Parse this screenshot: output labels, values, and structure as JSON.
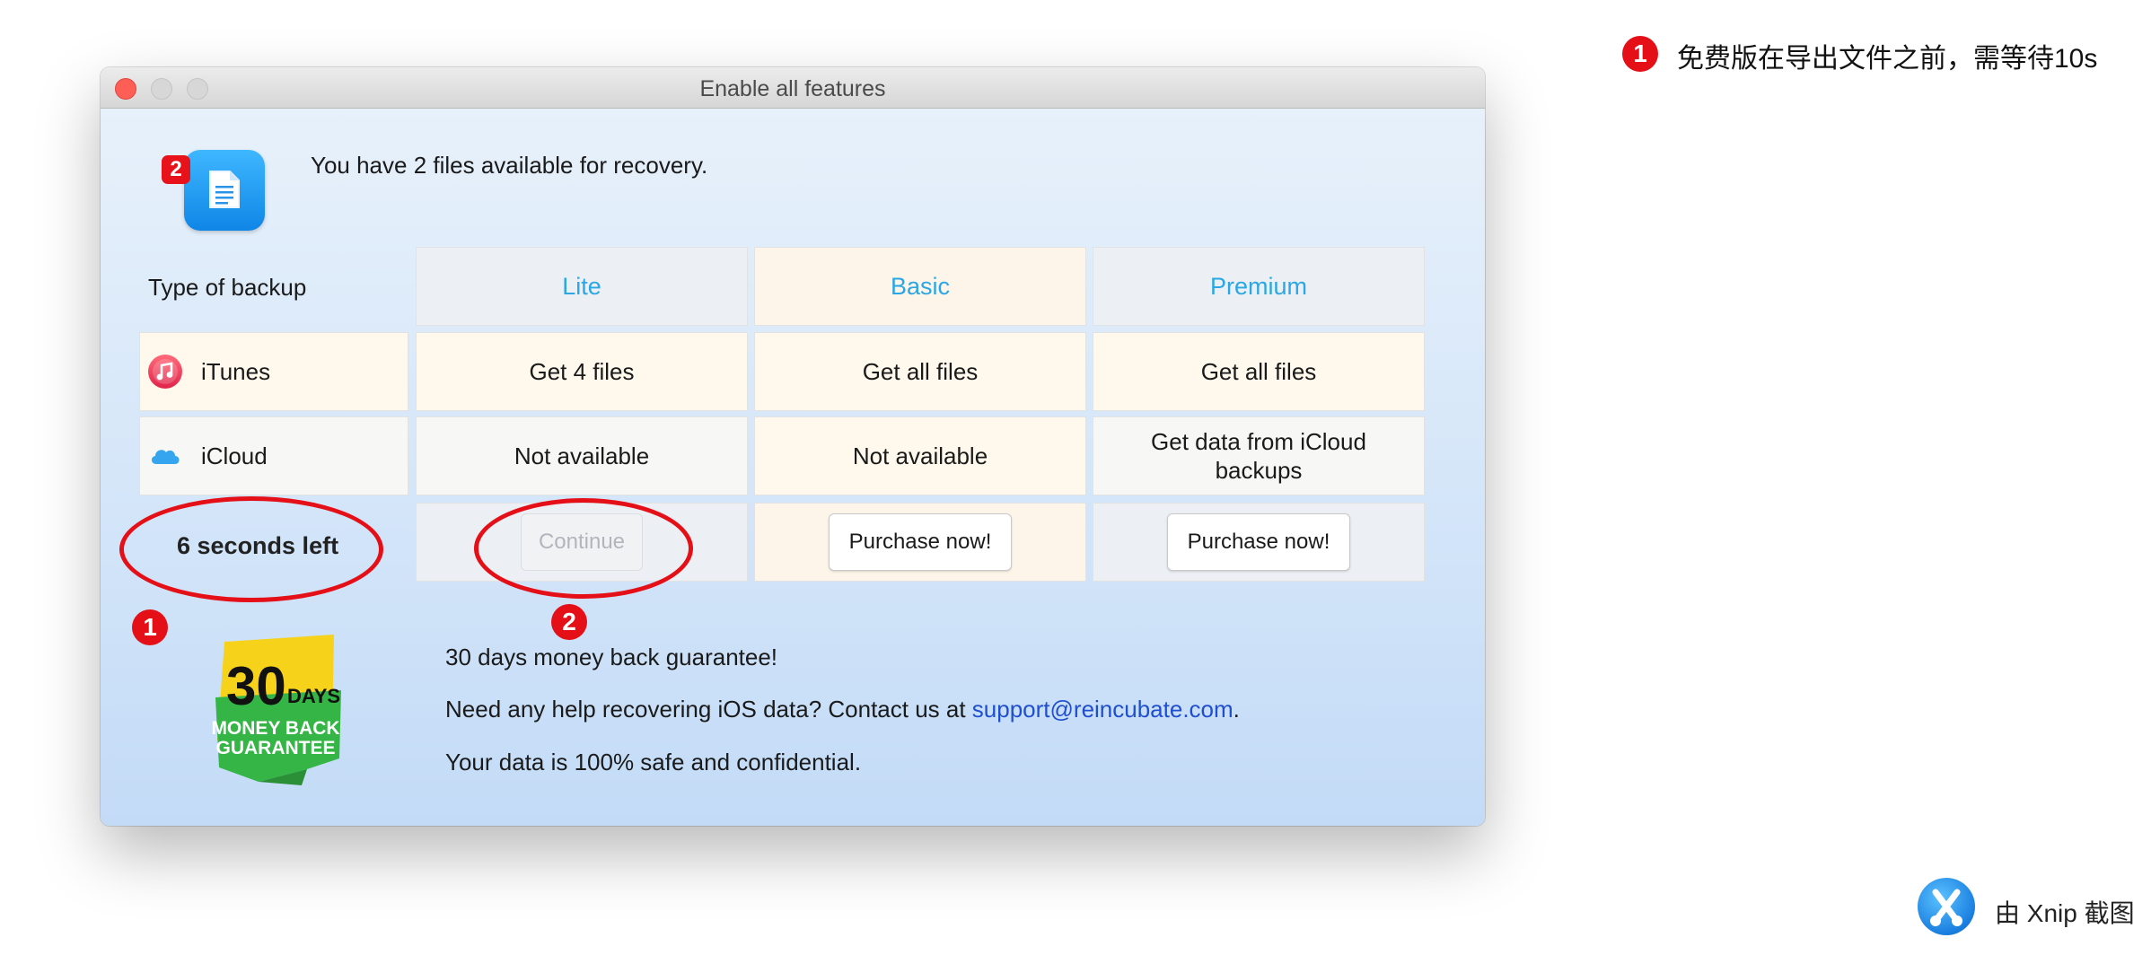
{
  "window": {
    "title": "Enable all features"
  },
  "header": {
    "file_count_badge": "2",
    "message": "You have 2 files available for recovery."
  },
  "table": {
    "type_label": "Type of backup",
    "plans": [
      "Lite",
      "Basic",
      "Premium"
    ],
    "rows": [
      {
        "label": "iTunes",
        "icon": "itunes-icon",
        "cells": [
          "Get 4 files",
          "Get all files",
          "Get all files"
        ]
      },
      {
        "label": "iCloud",
        "icon": "icloud-icon",
        "cells": [
          "Not available",
          "Not available",
          "Get data from iCloud backups"
        ]
      }
    ],
    "countdown": "6 seconds left",
    "actions": {
      "lite": "Continue",
      "basic": "Purchase now!",
      "premium": "Purchase now!"
    }
  },
  "footer": {
    "badge_lines": [
      "30",
      "DAYS",
      "MONEY BACK",
      "GUARANTEE"
    ],
    "guarantee": "30 days money back guarantee!",
    "help_prefix": "Need any help recovering iOS data? Contact us at ",
    "help_email": "support@reincubate.com",
    "help_suffix": ".",
    "safety": "Your data is 100% safe and confidential."
  },
  "annotations": {
    "marker_1": "1",
    "marker_2": "2",
    "note": "免费版在导出文件之前，需等待10s",
    "accent": "#e50f17"
  },
  "watermark": {
    "text": "由 Xnip 截图"
  }
}
